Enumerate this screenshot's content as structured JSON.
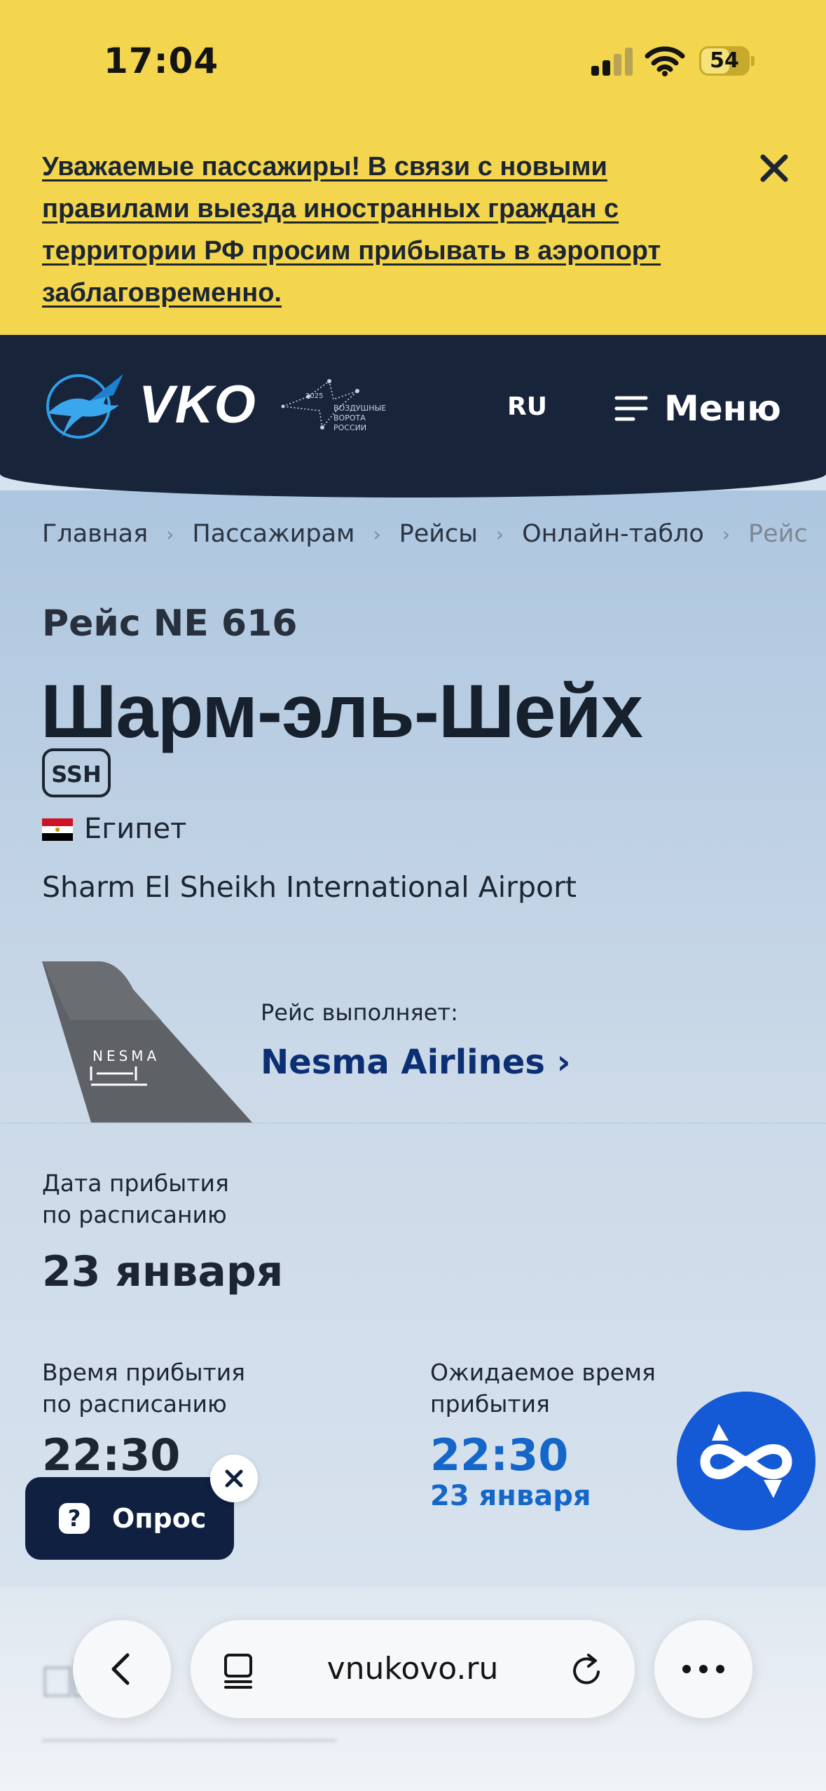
{
  "status_bar": {
    "time": "17:04",
    "battery": "54"
  },
  "notice": {
    "text": "Уважаемые пассажиры! В связи с новыми правилами выезда иностранных граждан с территории РФ просим прибывать в аэропорт заблаговременно."
  },
  "header": {
    "logo_text": "VKO",
    "gates_logo_year": "2025",
    "gates_logo_text": "ВОЗДУШНЫЕ ВОРОТА РОССИИ",
    "language": "RU",
    "menu_label": "Меню"
  },
  "breadcrumb": [
    "Главная",
    "Пассажирам",
    "Рейсы",
    "Онлайн-табло",
    "Рейс"
  ],
  "flight": {
    "number_label": "Рейс NE 616",
    "city": "Шарм-эль-Шейх",
    "iata": "SSH",
    "country": "Египет",
    "airport": "Sharm El Sheikh International Airport",
    "operator_label": "Рейс выполняет:",
    "operator_name": "Nesma Airlines",
    "operator_logo_text": "NESMA"
  },
  "arrival": {
    "date_label": "Дата прибытия\nпо расписанию",
    "date": "23 января",
    "sched_time_label": "Время прибытия\nпо расписанию",
    "sched_time": "22:30",
    "expected_label": "Ожидаемое время\nприбытия",
    "expected_time": "22:30",
    "expected_date": "23 января"
  },
  "survey": {
    "label": "Опрос",
    "icon": "?"
  },
  "browser": {
    "url": "vnukovo.ru"
  },
  "colors": {
    "notice_bg": "#f3d54e",
    "header_bg": "#17243a",
    "accent_blue": "#1466c8",
    "operator_link": "#0c2f74",
    "assistant_bg": "#1459d6"
  }
}
